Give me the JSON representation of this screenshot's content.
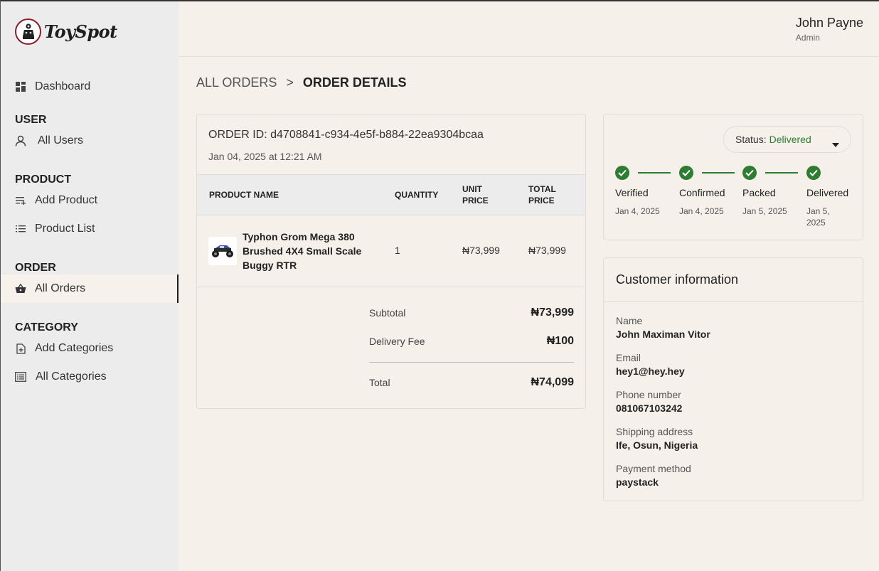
{
  "brand": {
    "name": "ToySpot"
  },
  "sidebar": {
    "dashboard": "Dashboard",
    "sections": {
      "user": "USER",
      "product": "PRODUCT",
      "order": "ORDER",
      "category": "CATEGORY"
    },
    "items": {
      "all_users": "All Users",
      "add_product": "Add Product",
      "product_list": "Product List",
      "all_orders": "All Orders",
      "add_categories": "Add Categories",
      "all_categories": "All Categories"
    },
    "active": "All Orders"
  },
  "header": {
    "user_name": "John Payne",
    "user_role": "Admin"
  },
  "breadcrumb": {
    "parent": "ALL ORDERS",
    "separator": ">",
    "current": "ORDER DETAILS"
  },
  "order": {
    "id_label": "ORDER ID:",
    "id": "d4708841-c934-4e5f-b884-22ea9304bcaa",
    "date": "Jan 04, 2025 at 12:21 AM",
    "columns": {
      "product": "PRODUCT NAME",
      "quantity": "QUANTITY",
      "unit_price_1": "UNIT",
      "unit_price_2": "PRICE",
      "total_price_1": "TOTAL",
      "total_price_2": "PRICE"
    },
    "items": [
      {
        "name_line1": "Typhon Grom Mega 380",
        "name_line2": "Brushed 4X4 Small Scale",
        "name_line3": "Buggy RTR",
        "quantity": "1",
        "unit_price": "₦73,999",
        "total_price": "₦73,999"
      }
    ],
    "summary": {
      "subtotal_label": "Subtotal",
      "subtotal": "₦73,999",
      "delivery_label": "Delivery Fee",
      "delivery": "₦100",
      "total_label": "Total",
      "total": "₦74,099"
    }
  },
  "status": {
    "prefix": "Status:",
    "value": "Delivered",
    "value_color": "#2e7d32",
    "steps": [
      {
        "label": "Verified",
        "date": "Jan 4, 2025"
      },
      {
        "label": "Confirmed",
        "date": "Jan 4, 2025"
      },
      {
        "label": "Packed",
        "date": "Jan 5, 2025"
      },
      {
        "label": "Delivered",
        "date_line1": "Jan 5,",
        "date_line2": "2025"
      }
    ]
  },
  "customer": {
    "title": "Customer information",
    "name_label": "Name",
    "name": "John Maximan Vitor",
    "email_label": "Email",
    "email": "hey1@hey.hey",
    "phone_label": "Phone number",
    "phone": "081067103242",
    "address_label": "Shipping address",
    "address": "Ife, Osun, Nigeria",
    "payment_label": "Payment method",
    "payment": "paystack"
  }
}
